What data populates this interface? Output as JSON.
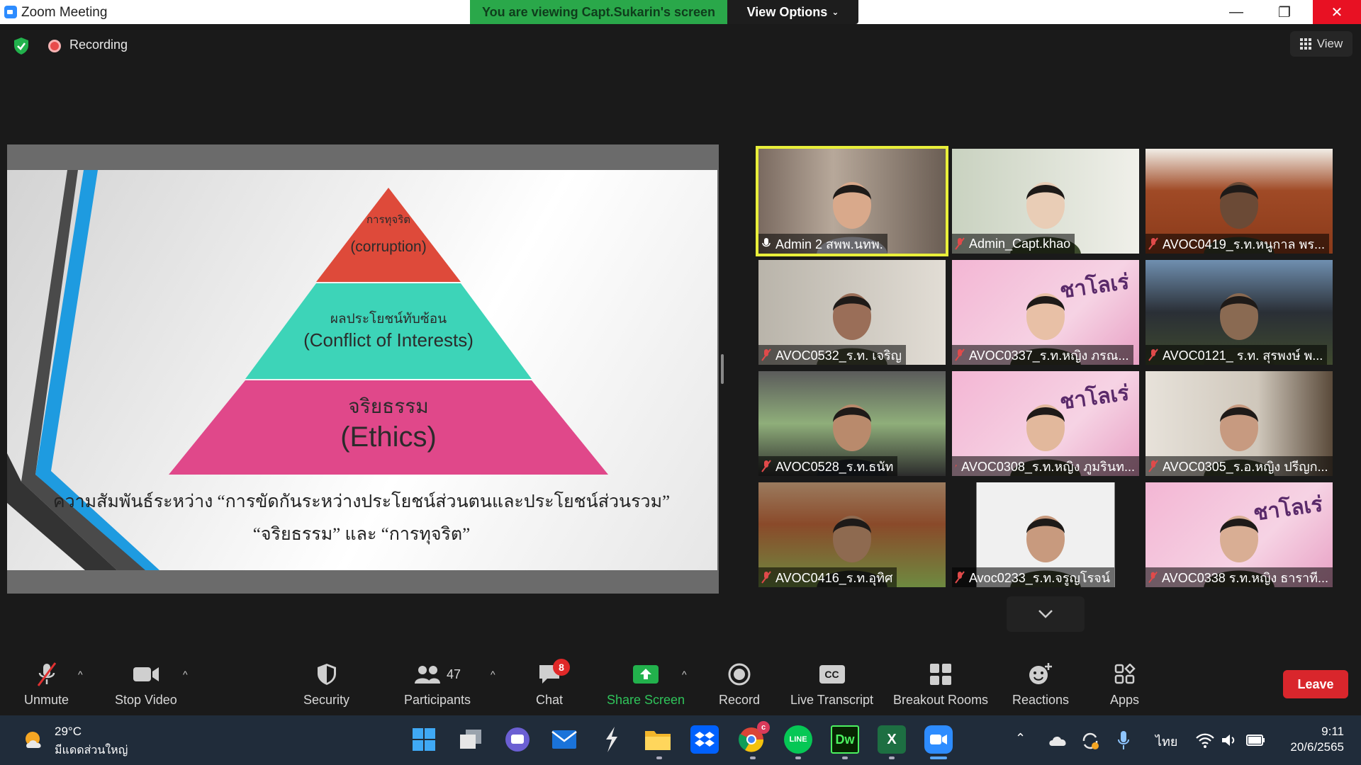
{
  "window": {
    "title": "Zoom Meeting",
    "viewing_banner": "You are viewing Capt.Sukarin's screen",
    "view_options_label": "View Options",
    "minimize": "—",
    "maximize": "❐",
    "close": "✕"
  },
  "status": {
    "recording_label": "Recording",
    "view_label": "View"
  },
  "slide": {
    "top_thai": "การทุจริต",
    "top_en": "(corruption)",
    "mid_thai": "ผลประโยชน์ทับซ้อน",
    "mid_en": "(Conflict of Interests)",
    "bottom_thai": "จริยธรรม",
    "bottom_en": "(Ethics)",
    "caption_line1": "ความสัมพันธ์ระหว่าง “การขัดกันระหว่างประโยชน์ส่วนตนและประโยชน์ส่วนรวม”",
    "caption_line2": "“จริยธรรม” และ “การทุจริต”",
    "colors": {
      "top": "#de4a3a",
      "middle": "#3dd4b8",
      "bottom": "#e0488a",
      "accent_blue": "#1e9be0"
    }
  },
  "participants": [
    {
      "name": "Admin 2 สพพ.นทพ.",
      "muted": false,
      "active": true
    },
    {
      "name": "Admin_Capt.khao",
      "muted": true,
      "active": false
    },
    {
      "name": "AVOC0419_ร.ท.หนูกาล พร...",
      "muted": true,
      "active": false
    },
    {
      "name": "AVOC0532_ร.ท. เจริญ",
      "muted": true,
      "active": false
    },
    {
      "name": "AVOC0337_ร.ท.หญิง ภรณ...",
      "muted": true,
      "active": false
    },
    {
      "name": "AVOC0121_ ร.ท. สุรพงษ์ พ...",
      "muted": true,
      "active": false
    },
    {
      "name": "AVOC0528_ร.ท.ธนัท",
      "muted": true,
      "active": false
    },
    {
      "name": "AVOC0308_ร.ท.หญิง ภูมรินท...",
      "muted": true,
      "active": false
    },
    {
      "name": "AVOC0305_ร.อ.หญิง ปรีญก...",
      "muted": true,
      "active": false
    },
    {
      "name": "AVOC0416_ร.ท.อุทิศ",
      "muted": true,
      "active": false
    },
    {
      "name": "Avoc0233_ร.ท.จรูญโรจน์",
      "muted": true,
      "active": false
    },
    {
      "name": "AVOC0338 ร.ท.หญิง ธาราที...",
      "muted": true,
      "active": false
    }
  ],
  "background_text": "ชาโลเร่",
  "toolbar": {
    "unmute": "Unmute",
    "stop_video": "Stop Video",
    "security": "Security",
    "participants": "Participants",
    "participants_count": "47",
    "chat": "Chat",
    "chat_badge": "8",
    "share_screen": "Share Screen",
    "record": "Record",
    "live_transcript": "Live Transcript",
    "breakout_rooms": "Breakout Rooms",
    "reactions": "Reactions",
    "apps": "Apps",
    "leave": "Leave",
    "cc": "CC"
  },
  "taskbar": {
    "temperature": "29°C",
    "weather": "มีแดดส่วนใหญ่",
    "language": "ไทย",
    "time": "9:11",
    "date": "20/6/2565",
    "dw_label": "Dw",
    "excel_label": "X",
    "line_label": "LINE",
    "chrome_badge": "c"
  },
  "colors": {
    "zoom_blue": "#2d8cff",
    "banner_green": "#2aa84a",
    "leave_red": "#d9262c",
    "share_green": "#22b14c",
    "active_speaker": "#e9ef3a"
  }
}
